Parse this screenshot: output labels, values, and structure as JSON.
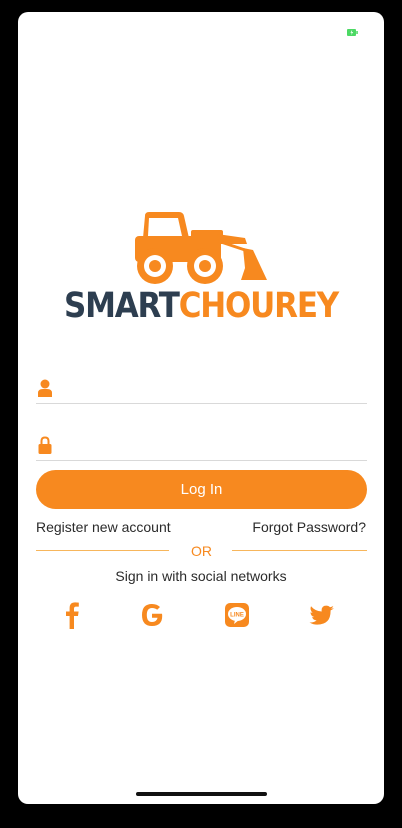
{
  "status_bar": {
    "battery_icon": "battery-charging-icon",
    "battery_color": "#4cd964"
  },
  "logo": {
    "brand_part1": "SMART",
    "brand_part2": "CHOUREY",
    "brand_dark_color": "#2d3e50",
    "brand_accent_color": "#f7891f",
    "art_icon": "loader-tractor-icon"
  },
  "form": {
    "username": {
      "value": "",
      "placeholder": "",
      "icon": "user-icon"
    },
    "password": {
      "value": "",
      "placeholder": "",
      "icon": "lock-icon"
    },
    "login_label": "Log In",
    "register_label": "Register new account",
    "forgot_label": "Forgot Password?"
  },
  "divider": {
    "label": "OR"
  },
  "social": {
    "caption": "Sign in with social networks",
    "networks": [
      "facebook-icon",
      "google-icon",
      "line-icon",
      "twitter-icon"
    ]
  },
  "accent_color": "#f7891f"
}
